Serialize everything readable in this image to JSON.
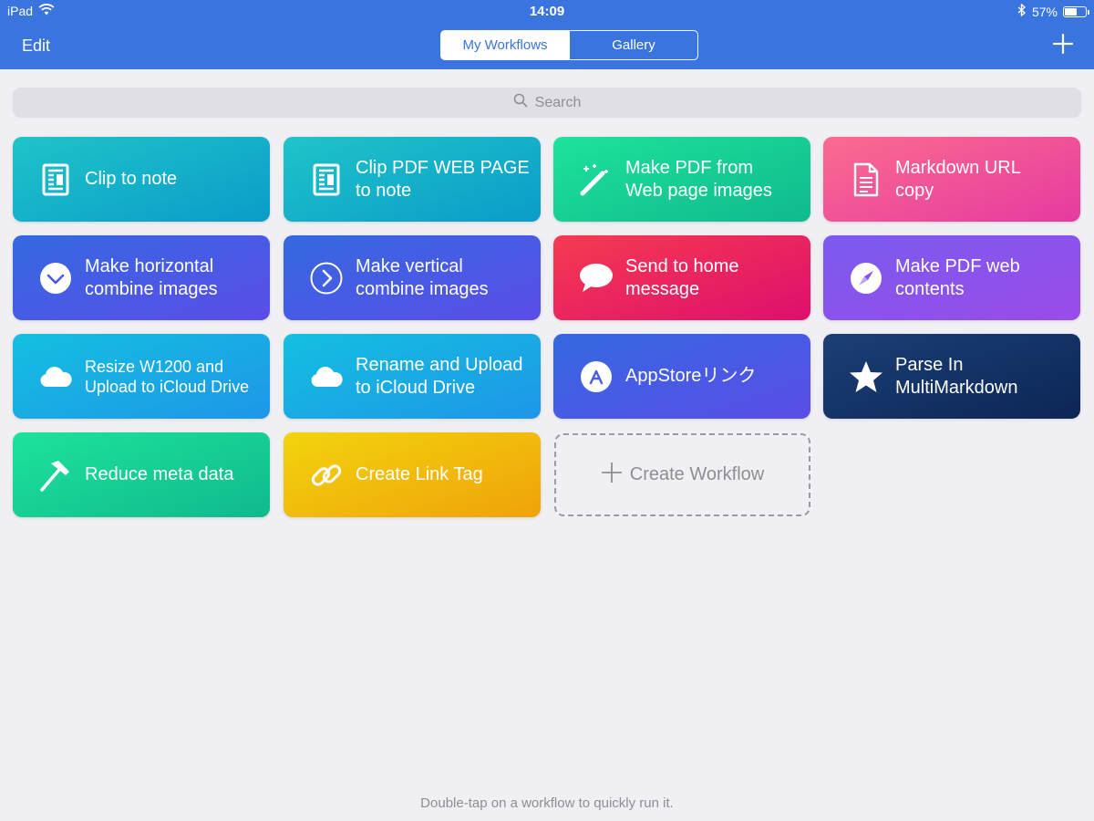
{
  "status_bar": {
    "device": "iPad",
    "time": "14:09",
    "battery": "57%",
    "battery_level": 0.57
  },
  "header": {
    "edit_label": "Edit",
    "tabs": [
      {
        "label": "My Workflows",
        "active": true
      },
      {
        "label": "Gallery",
        "active": false
      }
    ],
    "add_icon": "plus-icon",
    "background_color": "#3a74de"
  },
  "search": {
    "placeholder": "Search",
    "icon": "search-icon"
  },
  "workflows": [
    {
      "label": "Clip to note",
      "icon": "document-icon",
      "colors": [
        "#1fc4c9",
        "#0a9cc9"
      ]
    },
    {
      "label": "Clip PDF WEB PAGE\nto note",
      "icon": "document-icon",
      "colors": [
        "#1fc4c9",
        "#0a9cc9"
      ]
    },
    {
      "label": "Make PDF from\nWeb page images",
      "icon": "magic-wand-icon",
      "colors": [
        "#1de39b",
        "#10b98d"
      ]
    },
    {
      "label": "Markdown URL\ncopy",
      "icon": "text-file-icon",
      "colors": [
        "#fb6c8f",
        "#e63aa0"
      ]
    },
    {
      "label": "Make horizontal\ncombine images",
      "icon": "chevron-down-circle-icon",
      "colors": [
        "#3469e0",
        "#5b4de8"
      ]
    },
    {
      "label": "Make vertical\ncombine images",
      "icon": "chevron-right-circle-icon",
      "colors": [
        "#3469e0",
        "#5b4de8"
      ]
    },
    {
      "label": "Send to home\nmessage",
      "icon": "speech-bubble-icon",
      "colors": [
        "#f53b50",
        "#de0f6e"
      ]
    },
    {
      "label": "Make PDF web\ncontents",
      "icon": "compass-icon",
      "colors": [
        "#7a5bf0",
        "#9a4be8"
      ]
    },
    {
      "label": "Resize W1200 and\nUpload to iCloud Drive",
      "icon": "cloud-icon",
      "colors": [
        "#14c0e0",
        "#1e96e8"
      ]
    },
    {
      "label": "Rename and Upload\nto iCloud Drive",
      "icon": "cloud-icon",
      "colors": [
        "#14c0e0",
        "#1e96e8"
      ]
    },
    {
      "label": "AppStoreリンク",
      "icon": "app-store-icon",
      "colors": [
        "#3469e0",
        "#5b4de8"
      ]
    },
    {
      "label": "Parse In\nMultiMarkdown",
      "icon": "star-icon",
      "colors": [
        "#1c3f76",
        "#0c2656"
      ]
    },
    {
      "label": "Reduce meta data",
      "icon": "hammer-icon",
      "colors": [
        "#1de39b",
        "#10b98d"
      ]
    },
    {
      "label": "Create Link Tag",
      "icon": "link-icon",
      "colors": [
        "#f2d40e",
        "#f0a20a"
      ]
    }
  ],
  "create_workflow": {
    "label": "Create Workflow",
    "icon": "plus-icon"
  },
  "footer_hint": "Double-tap on a workflow to quickly run it."
}
